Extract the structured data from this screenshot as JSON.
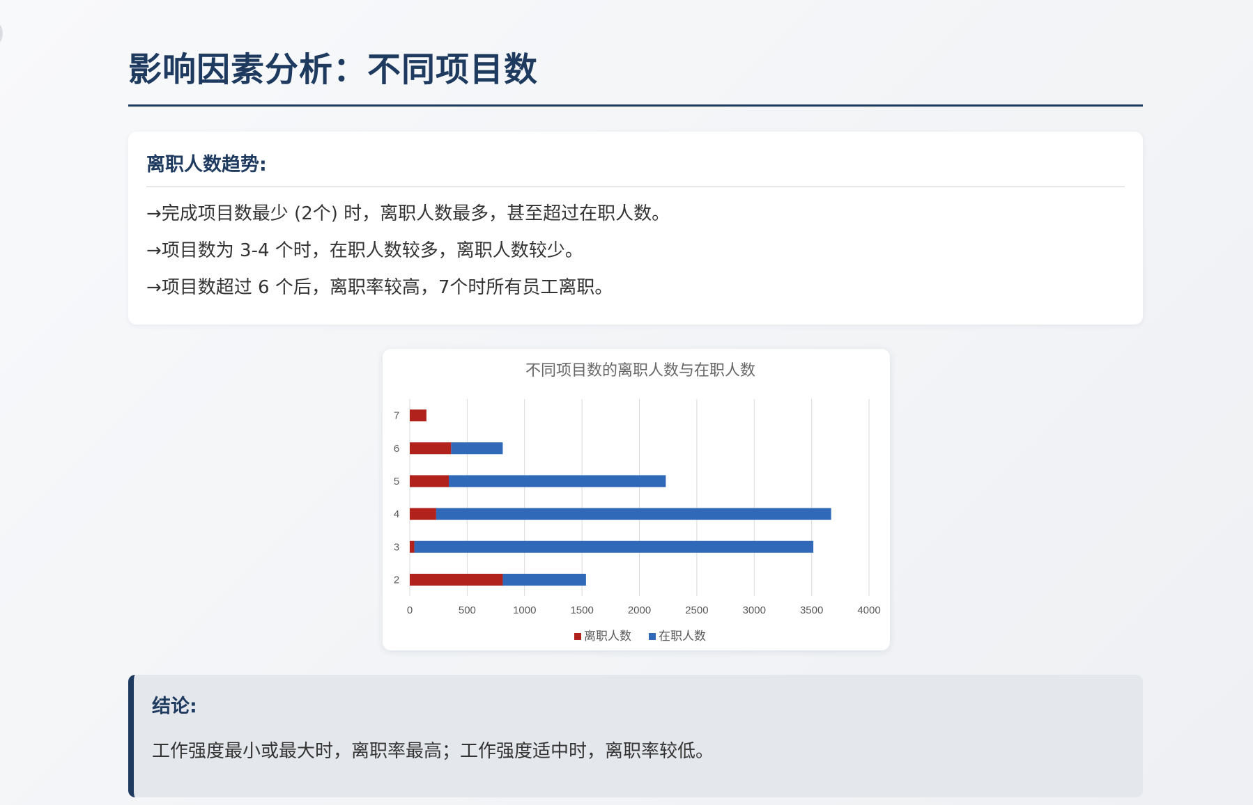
{
  "page": {
    "title": "影响因素分析：不同项目数"
  },
  "trend": {
    "heading": "离职人数趋势:",
    "items": [
      "→完成项目数最少 (2个) 时，离职人数最多，甚至超过在职人数。",
      "→项目数为 3-4 个时，在职人数较多，离职人数较少。",
      "→项目数超过 6 个后，离职率较高，7个时所有员工离职。"
    ]
  },
  "conclusion": {
    "heading": "结论:",
    "text": "工作强度最小或最大时，离职率最高；工作强度适中时，离职率较低。"
  },
  "chart_data": {
    "type": "bar",
    "orientation": "horizontal",
    "stacked": true,
    "title": "不同项目数的离职人数与在职人数",
    "xlabel": "",
    "ylabel": "",
    "categories": [
      "2",
      "3",
      "4",
      "5",
      "6",
      "7"
    ],
    "series": [
      {
        "name": "离职人数",
        "color": "#b0221b",
        "values": [
          810,
          40,
          230,
          340,
          360,
          145
        ]
      },
      {
        "name": "在职人数",
        "color": "#2f69b8",
        "values": [
          725,
          3475,
          3440,
          1890,
          450,
          0
        ]
      }
    ],
    "xlim": [
      0,
      4000
    ],
    "xticks": [
      0,
      500,
      1000,
      1500,
      2000,
      2500,
      3000,
      3500,
      4000
    ],
    "grid": true,
    "legend": "bottom"
  }
}
